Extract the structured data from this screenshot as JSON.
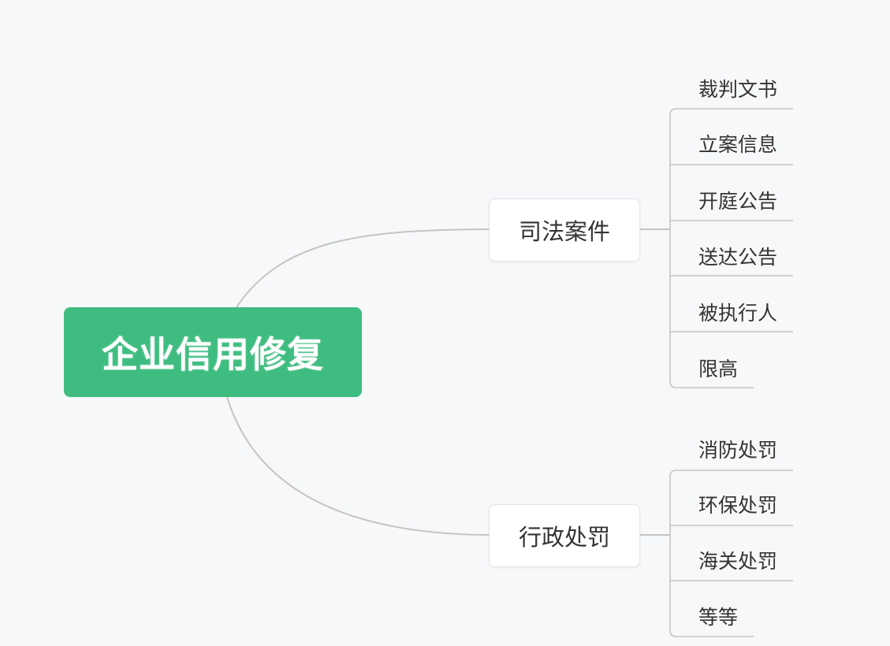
{
  "root": {
    "label": "企业信用修复"
  },
  "branches": [
    {
      "label": "司法案件",
      "children": [
        "裁判文书",
        "立案信息",
        "开庭公告",
        "送达公告",
        "被执行人",
        "限高"
      ]
    },
    {
      "label": "行政处罚",
      "children": [
        "消防处罚",
        "环保处罚",
        "海关处罚",
        "等等"
      ]
    }
  ],
  "colors": {
    "root_fill": "#3fbd80",
    "background": "#f6f8fa",
    "connector": "#c4c4c4",
    "text": "#333333"
  }
}
